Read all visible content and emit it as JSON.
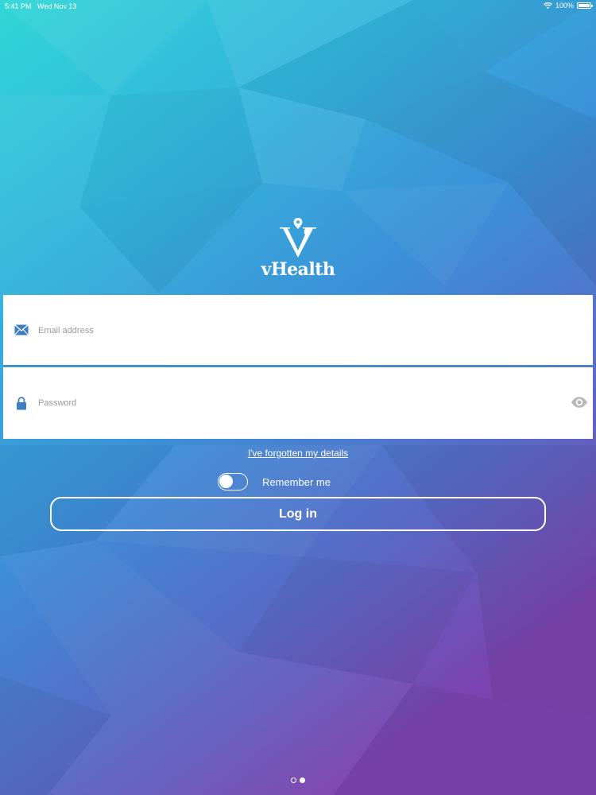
{
  "status_bar": {
    "time": "5:41 PM",
    "date": "Wed Nov 13",
    "battery": "100%",
    "battery_level": 1.0,
    "wifi_icon": "wifi-icon",
    "battery_icon": "battery-icon"
  },
  "logo": {
    "text": "vHealth",
    "icon": "vhealth-logo-icon"
  },
  "login_form": {
    "email": {
      "value": "",
      "placeholder": "Email address",
      "icon": "envelope-icon"
    },
    "password": {
      "value": "",
      "placeholder": "Password",
      "icon": "lock-icon",
      "toggle_icon": "eye-icon"
    },
    "forgot_link": "I've forgotten my details",
    "remember_me": {
      "label": "Remember me",
      "checked": false
    },
    "login_button": "Log in"
  },
  "pagination": {
    "total": 2,
    "current": 2
  },
  "colors": {
    "gradient_top": "#2fd3d8",
    "gradient_mid": "#3a8fd6",
    "gradient_bottom": "#7b45b2",
    "field_background": "#ffffff",
    "field_icon": "#3d7ec2",
    "placeholder": "#9a9a9a",
    "eye_icon": "#b9b9b9",
    "text_light": "#ffffff"
  }
}
